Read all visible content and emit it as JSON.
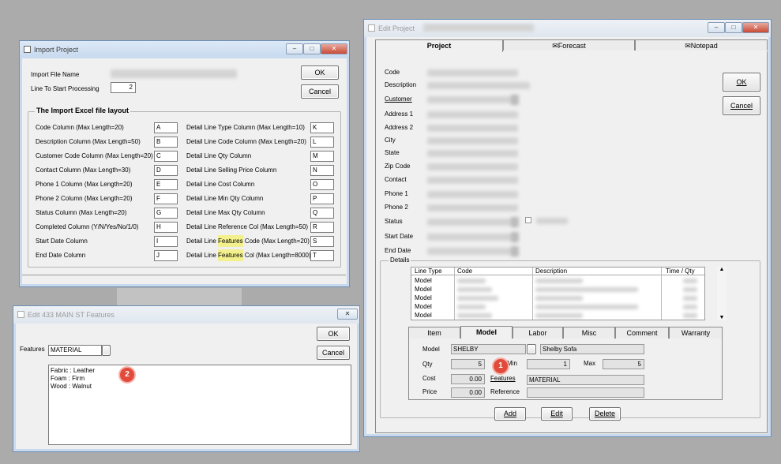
{
  "import_dialog": {
    "title": "Import Project",
    "file_label": "Import File Name",
    "line_label": "Line To Start Processing",
    "line_value": "2",
    "ok": "OK",
    "cancel": "Cancel",
    "group_title": "The Import Excel file layout",
    "left_rows": [
      {
        "label": "Code Column (Max Length=20)",
        "value": "A"
      },
      {
        "label": "Description Column (Max Length=50)",
        "value": "B"
      },
      {
        "label": "Customer Code Column (Max Length=20)",
        "value": "C"
      },
      {
        "label": "Contact Column (Max Length=30)",
        "value": "D"
      },
      {
        "label": "Phone 1 Column (Max Length=20)",
        "value": "E"
      },
      {
        "label": "Phone 2 Column (Max Length=20)",
        "value": "F"
      },
      {
        "label": "Status Column  (Max Length=20)",
        "value": "G"
      },
      {
        "label": "Completed Column  (Y/N/Yes/No/1/0)",
        "value": "H"
      },
      {
        "label": "Start Date Column",
        "value": "I"
      },
      {
        "label": "End Date Column",
        "value": "J"
      }
    ],
    "right_rows": [
      {
        "pre": "Detail Line Type Column (Max Length=10)",
        "hl": "",
        "post": "",
        "value": "K"
      },
      {
        "pre": "Detail Line Code Column (Max Length=20)",
        "hl": "",
        "post": "",
        "value": "L"
      },
      {
        "pre": "Detail Line Qty Column",
        "hl": "",
        "post": "",
        "value": "M"
      },
      {
        "pre": "Detail Line Selling Price Column",
        "hl": "",
        "post": "",
        "value": "N"
      },
      {
        "pre": "Detail Line Cost Column",
        "hl": "",
        "post": "",
        "value": "O"
      },
      {
        "pre": "Detail Line Min Qty Column",
        "hl": "",
        "post": "",
        "value": "P"
      },
      {
        "pre": "Detail Line Max Qty Column",
        "hl": "",
        "post": "",
        "value": "Q"
      },
      {
        "pre": "Detail Line Reference Col (Max Length=50)",
        "hl": "",
        "post": "",
        "value": "R"
      },
      {
        "pre": "Detail Line ",
        "hl": "Features",
        "post": " Code (Max Length=20)",
        "value": "S"
      },
      {
        "pre": "Detail Line ",
        "hl": "Features",
        "post": " Col (Max Length=8000)",
        "value": "T"
      }
    ]
  },
  "features_dialog": {
    "title": "Edit 433 MAIN ST Features",
    "features_label": "Features",
    "features_value": "MATERIAL",
    "ok": "OK",
    "cancel": "Cancel",
    "lines": [
      "Fabric :  Leather",
      "Foam :  Firm",
      "Wood : Walnut"
    ],
    "badge": "2"
  },
  "edit_project": {
    "title": "Edit Project",
    "tabs": [
      "Project",
      "Forecast",
      "Notepad"
    ],
    "ok": "OK",
    "cancel": "Cancel",
    "field_labels": [
      "Code",
      "Description",
      "Customer",
      "Address 1",
      "Address 2",
      "City",
      "State",
      "Zip Code",
      "Contact",
      "Phone 1",
      "Phone 2",
      "Status",
      "Start Date",
      "End Date"
    ],
    "details_label": "Details",
    "grid_headers": [
      "Line Type",
      "Code",
      "Description",
      "Time  /  Qty"
    ],
    "grid_rows": [
      "Model",
      "Model",
      "Model",
      "Model",
      "Model"
    ],
    "sub_tabs": [
      "Item",
      "Model",
      "Labor",
      "Misc",
      "Comment",
      "Warranty"
    ],
    "model_label": "Model",
    "model_code": "SHELBY",
    "model_desc": "Shelby Sofa",
    "qty_label": "Qty",
    "qty_value": "5",
    "min_label": "Min",
    "min_value": "1",
    "max_label": "Max",
    "max_value": "5",
    "cost_label": "Cost",
    "cost_value": "0.00",
    "features_link": "Features",
    "features_value": "MATERIAL",
    "price_label": "Price",
    "price_value": "0.00",
    "reference_label": "Reference",
    "add": "Add",
    "edit": "Edit",
    "delete": "Delete",
    "badge": "1"
  }
}
